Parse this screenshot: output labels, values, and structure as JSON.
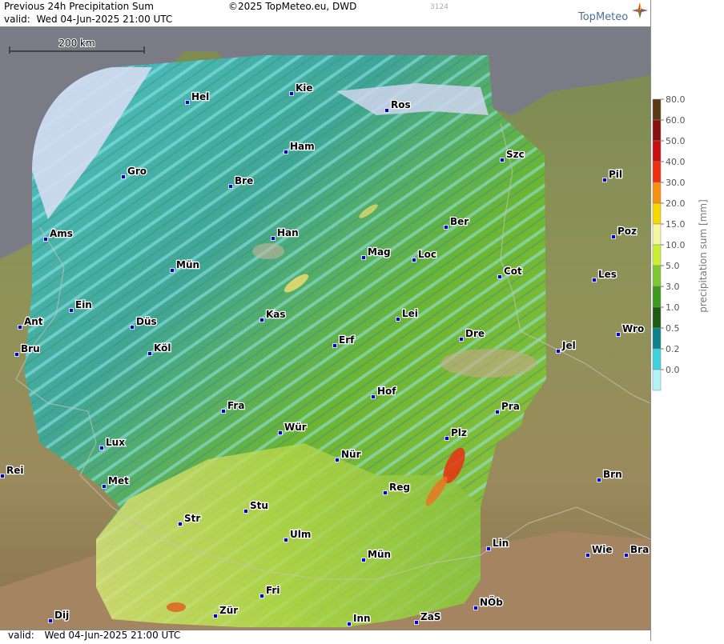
{
  "header": {
    "title": "Previous 24h Precipitation Sum",
    "valid_label": "valid:",
    "valid_value": "Wed  04-Jun-2025 21:00 UTC",
    "copyright": "©2025 TopMeteo.eu, DWD",
    "code": "3124",
    "brand": "TopMeteo"
  },
  "scale_bar": {
    "label": "200 km"
  },
  "footer": {
    "valid_label": "valid:",
    "valid_value": "Wed  04-Jun-2025 21:00 UTC"
  },
  "legend": {
    "title": "precipitation sum [mm]",
    "ticks": [
      "80.0",
      "60.0",
      "50.0",
      "40.0",
      "30.0",
      "20.0",
      "15.0",
      "10.0",
      "5.0",
      "3.0",
      "1.0",
      "0.5",
      "0.2",
      "0.0"
    ],
    "colors": [
      "#5a3a14",
      "#8a1010",
      "#c81010",
      "#ee3010",
      "#f59010",
      "#f5d800",
      "#f5f6a0",
      "#c8f030",
      "#7ec832",
      "#3e9a1e",
      "#1e5a12",
      "#10808a",
      "#40d2dc",
      "#b4f2f6"
    ]
  },
  "cities": [
    {
      "name": "Hel"
    },
    {
      "name": "Kie"
    },
    {
      "name": "Ros"
    },
    {
      "name": "Ham"
    },
    {
      "name": "Szc"
    },
    {
      "name": "Gro"
    },
    {
      "name": "Bre"
    },
    {
      "name": "Pil"
    },
    {
      "name": "Ber"
    },
    {
      "name": "Ams"
    },
    {
      "name": "Han"
    },
    {
      "name": "Poz"
    },
    {
      "name": "Mag"
    },
    {
      "name": "Loc"
    },
    {
      "name": "Mün"
    },
    {
      "name": "Cot"
    },
    {
      "name": "Les"
    },
    {
      "name": "Ein"
    },
    {
      "name": "Kas"
    },
    {
      "name": "Lei"
    },
    {
      "name": "Ant"
    },
    {
      "name": "Düs"
    },
    {
      "name": "Wro"
    },
    {
      "name": "Dre"
    },
    {
      "name": "Erf"
    },
    {
      "name": "Bru"
    },
    {
      "name": "Köl"
    },
    {
      "name": "Jel"
    },
    {
      "name": "Hof"
    },
    {
      "name": "Fra"
    },
    {
      "name": "Pra"
    },
    {
      "name": "Wür"
    },
    {
      "name": "Plz"
    },
    {
      "name": "Lux"
    },
    {
      "name": "Nür"
    },
    {
      "name": "Rei"
    },
    {
      "name": "Brn"
    },
    {
      "name": "Met"
    },
    {
      "name": "Reg"
    },
    {
      "name": "Stu"
    },
    {
      "name": "Str"
    },
    {
      "name": "Ulm"
    },
    {
      "name": "Lin"
    },
    {
      "name": "Wie"
    },
    {
      "name": "Bra"
    },
    {
      "name": "Mün"
    },
    {
      "name": "Fri"
    },
    {
      "name": "NÖb"
    },
    {
      "name": "Dij"
    },
    {
      "name": "Zür"
    },
    {
      "name": "Inn"
    },
    {
      "name": "ZaS"
    }
  ]
}
